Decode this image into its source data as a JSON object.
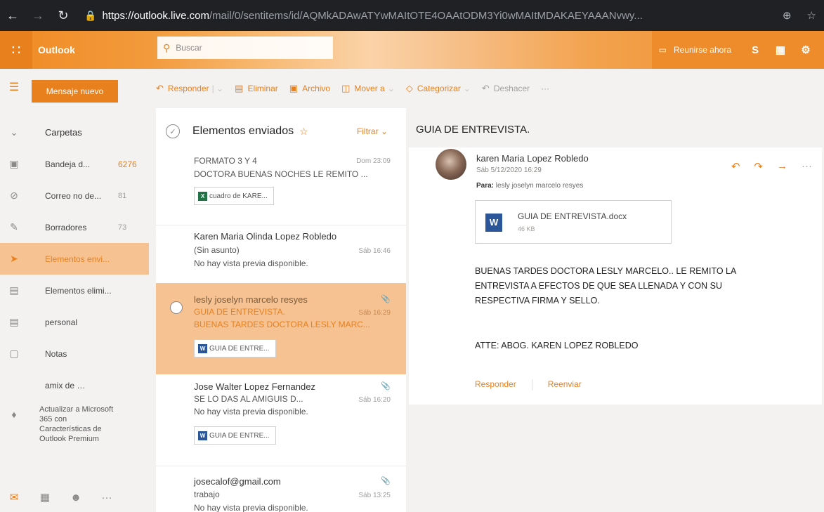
{
  "browser": {
    "url_host": "https://outlook.live.com",
    "url_path": "/mail/0/sentitems/id/AQMkADAwATYwMAItOTE4OAAtODM3Yi0wMAItMDAKAEYAAANvwy..."
  },
  "header": {
    "brand": "Outlook",
    "search_placeholder": "Buscar",
    "meet_now": "Reunirse ahora"
  },
  "sidebar": {
    "new_message": "Mensaje nuevo",
    "folders_header": "Carpetas",
    "items": [
      {
        "label": "Bandeja d...",
        "count": "6276",
        "icon": "inbox-icon"
      },
      {
        "label": "Correo no de...",
        "count": "81",
        "icon": "junk-icon"
      },
      {
        "label": "Borradores",
        "count": "73",
        "icon": "drafts-icon"
      },
      {
        "label": "Elementos envi...",
        "count": "",
        "icon": "sent-icon"
      },
      {
        "label": "Elementos elimi...",
        "count": "",
        "icon": "trash-icon"
      },
      {
        "label": "personal",
        "count": "",
        "icon": "folder-icon"
      },
      {
        "label": "Notas",
        "count": "",
        "icon": "notes-icon"
      },
      {
        "label": "amix de lonsa",
        "count": ""
      }
    ],
    "upgrade": "Actualizar a Microsoft 365 con Características de Outlook Premium"
  },
  "toolbar": {
    "reply": "Responder",
    "delete": "Eliminar",
    "archive": "Archivo",
    "move": "Mover a",
    "categorize": "Categorizar",
    "undo": "Deshacer",
    "more": "···"
  },
  "message_list": {
    "title": "Elementos enviados",
    "filter": "Filtrar",
    "messages": [
      {
        "sender": "FORMATO 3 Y 4",
        "subject": "DOCTORA BUENAS NOCHES LE REMITO ...",
        "preview": "",
        "date": "Dom 23:09",
        "attachment": "cuadro de KARE..."
      },
      {
        "sender": "Karen Maria Olinda Lopez Robledo",
        "subject": "(Sin asunto)",
        "preview": "No hay vista previa disponible.",
        "date": "Sáb 16:46",
        "attachment": ""
      },
      {
        "sender": "lesly joselyn marcelo resyes",
        "subject": "GUIA DE ENTREVISTA.",
        "preview": "BUENAS TARDES DOCTORA LESLY MARC...",
        "date": "Sáb 16:29",
        "attachment": "GUIA DE ENTRE..."
      },
      {
        "sender": "Jose Walter Lopez Fernandez",
        "subject": "SE LO DAS AL AMIGUIS D...",
        "preview": "No hay vista previa disponible.",
        "date": "Sáb 16:20",
        "attachment": "GUIA DE ENTRE..."
      },
      {
        "sender": "josecalof@gmail.com",
        "subject": "trabajo",
        "preview": "No hay vista previa disponible.",
        "date": "Sáb 13:25",
        "attachment": ""
      }
    ]
  },
  "reading": {
    "subject": "GUIA DE ENTREVISTA.",
    "from": "karen Maria Lopez Robledo",
    "date": "Sáb 5/12/2020 16:29",
    "to_label": "Para:",
    "to": "lesly joselyn marcelo resyes",
    "attachment_name": "GUIA DE ENTREVISTA.docx",
    "attachment_size": "46 KB",
    "body": "BUENAS TARDES DOCTORA LESLY MARCELO.. LE REMITO LA ENTREVISTA A EFECTOS DE QUE SEA LLENADA Y CON SU RESPECTIVA FIRMA Y SELLO.",
    "signature": "ATTE: ABOG. KAREN LOPEZ ROBLEDO",
    "reply_button": "Responder",
    "forward_button": "Reenviar"
  },
  "colors": {
    "accent": "#e8801e",
    "selected_bg": "#f7c291",
    "browser_bar": "#202124"
  }
}
